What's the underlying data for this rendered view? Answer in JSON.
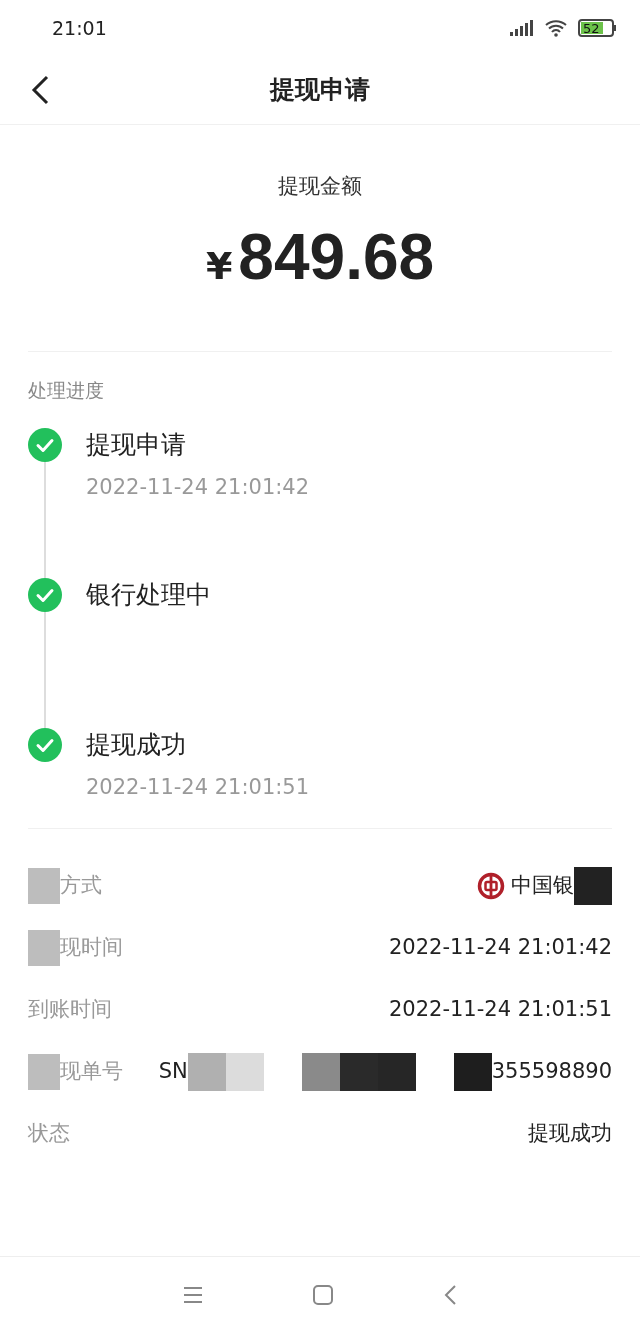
{
  "status_bar": {
    "time": "21:01",
    "battery": "52"
  },
  "header": {
    "title": "提现申请"
  },
  "amount": {
    "label": "提现金额",
    "currency": "¥",
    "value": "849.68"
  },
  "progress": {
    "title": "处理进度",
    "steps": [
      {
        "title": "提现申请",
        "time": "2022-11-24 21:01:42",
        "done": true
      },
      {
        "title": "银行处理中",
        "done": true
      },
      {
        "title": "提现成功",
        "time": "2022-11-24 21:01:51",
        "done": true
      }
    ]
  },
  "details": [
    {
      "label": [
        {
          "kind": "redaction",
          "color": "#bdbdbd"
        },
        {
          "kind": "text",
          "text": "方式"
        }
      ],
      "value": [
        {
          "kind": "bank-logo"
        },
        {
          "kind": "text",
          "text": "中国银"
        },
        {
          "kind": "redaction",
          "color": "#222222"
        }
      ]
    },
    {
      "label": [
        {
          "kind": "redaction",
          "color": "#bdbdbd"
        },
        {
          "kind": "text",
          "text": "现时间"
        }
      ],
      "value": [
        {
          "kind": "text",
          "text": "2022-11-24 21:01:42"
        }
      ]
    },
    {
      "label": [
        {
          "kind": "text",
          "text": "到账时间"
        }
      ],
      "value": [
        {
          "kind": "text",
          "text": "2022-11-24 21:01:51"
        }
      ]
    },
    {
      "label": [
        {
          "kind": "redaction",
          "color": "#bdbdbd"
        },
        {
          "kind": "text",
          "text": "现单号"
        }
      ],
      "value": [
        {
          "kind": "text",
          "text": "SN"
        },
        {
          "kind": "redaction",
          "color": "#b0b0b0"
        },
        {
          "kind": "redaction",
          "color": "#dcdcdc"
        },
        {
          "kind": "gap"
        },
        {
          "kind": "redaction",
          "color": "#8a8a8a"
        },
        {
          "kind": "redaction",
          "color": "#2a2a2a"
        },
        {
          "kind": "redaction",
          "color": "#262626"
        },
        {
          "kind": "gap"
        },
        {
          "kind": "redaction",
          "color": "#1e1e1e"
        },
        {
          "kind": "text",
          "text": "355598890"
        }
      ]
    },
    {
      "label": [
        {
          "kind": "text",
          "text": "状态"
        }
      ],
      "value": [
        {
          "kind": "text",
          "text": "提现成功"
        }
      ]
    }
  ]
}
